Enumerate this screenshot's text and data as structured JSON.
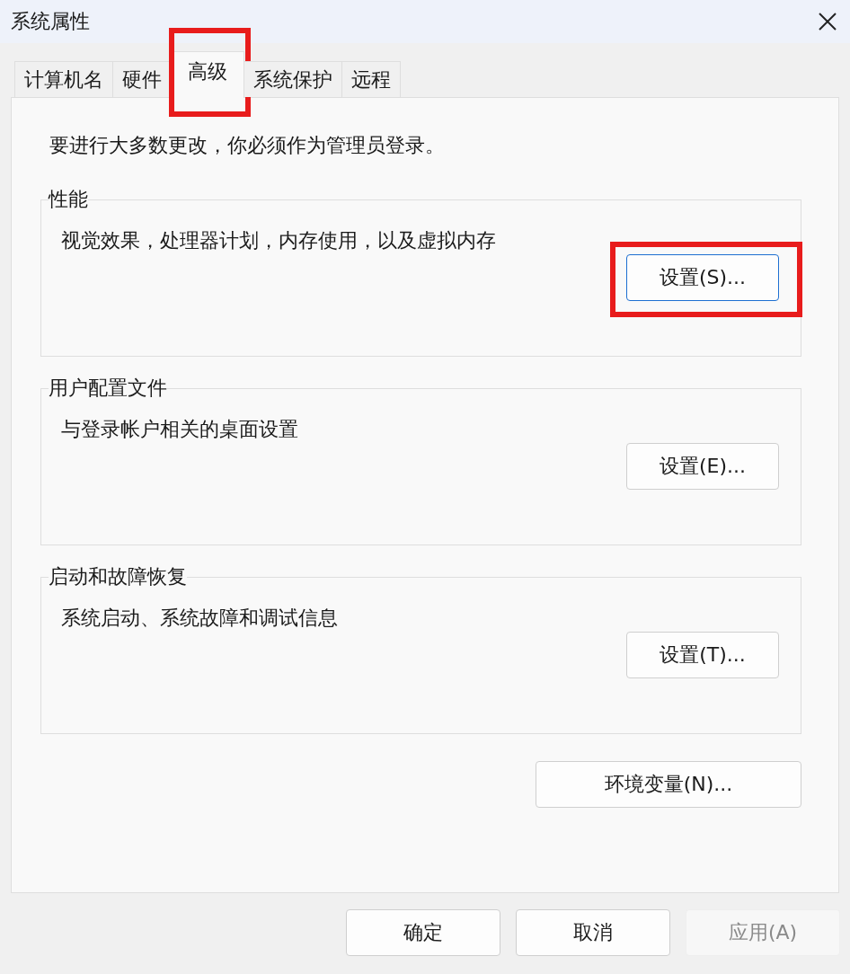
{
  "window": {
    "title": "系统属性"
  },
  "tabs": [
    {
      "label": "计算机名",
      "selected": false,
      "highlighted": false
    },
    {
      "label": "硬件",
      "selected": false,
      "highlighted": false
    },
    {
      "label": "高级",
      "selected": true,
      "highlighted": true
    },
    {
      "label": "系统保护",
      "selected": false,
      "highlighted": false
    },
    {
      "label": "远程",
      "selected": false,
      "highlighted": false
    }
  ],
  "notice": "要进行大多数更改，你必须作为管理员登录。",
  "groups": [
    {
      "legend": "性能",
      "description": "视觉效果，处理器计划，内存使用，以及虚拟内存",
      "button": {
        "label": "设置(S)...",
        "highlighted": true,
        "focused": true
      }
    },
    {
      "legend": "用户配置文件",
      "description": "与登录帐户相关的桌面设置",
      "button": {
        "label": "设置(E)...",
        "highlighted": false,
        "focused": false
      }
    },
    {
      "legend": "启动和故障恢复",
      "description": "系统启动、系统故障和调试信息",
      "button": {
        "label": "设置(T)...",
        "highlighted": false,
        "focused": false
      }
    }
  ],
  "env_button": {
    "label": "环境变量(N)..."
  },
  "footer_buttons": [
    {
      "label": "确定",
      "disabled": false
    },
    {
      "label": "取消",
      "disabled": false
    },
    {
      "label": "应用(A)",
      "disabled": true
    }
  ]
}
